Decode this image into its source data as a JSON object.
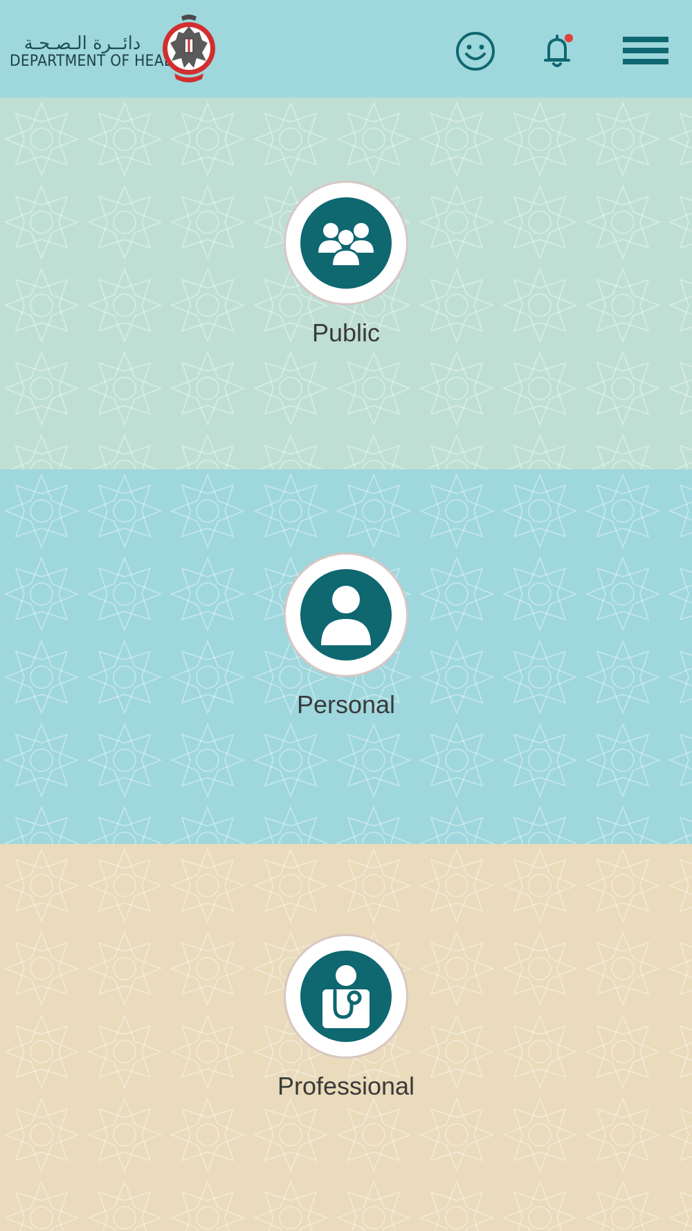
{
  "header": {
    "logo_ar": "دائــرة الـصـحـة",
    "logo_en": "DEPARTMENT OF HEALTH",
    "notification_dot_color": "#e0413a",
    "accent": "#0f6770"
  },
  "tiles": [
    {
      "label": "Public",
      "icon": "people-group-icon",
      "bg": "#bfdfd4"
    },
    {
      "label": "Personal",
      "icon": "person-icon",
      "bg": "#9ed7dd"
    },
    {
      "label": "Professional",
      "icon": "doctor-stethoscope-icon",
      "bg": "#e9dbbb"
    }
  ]
}
